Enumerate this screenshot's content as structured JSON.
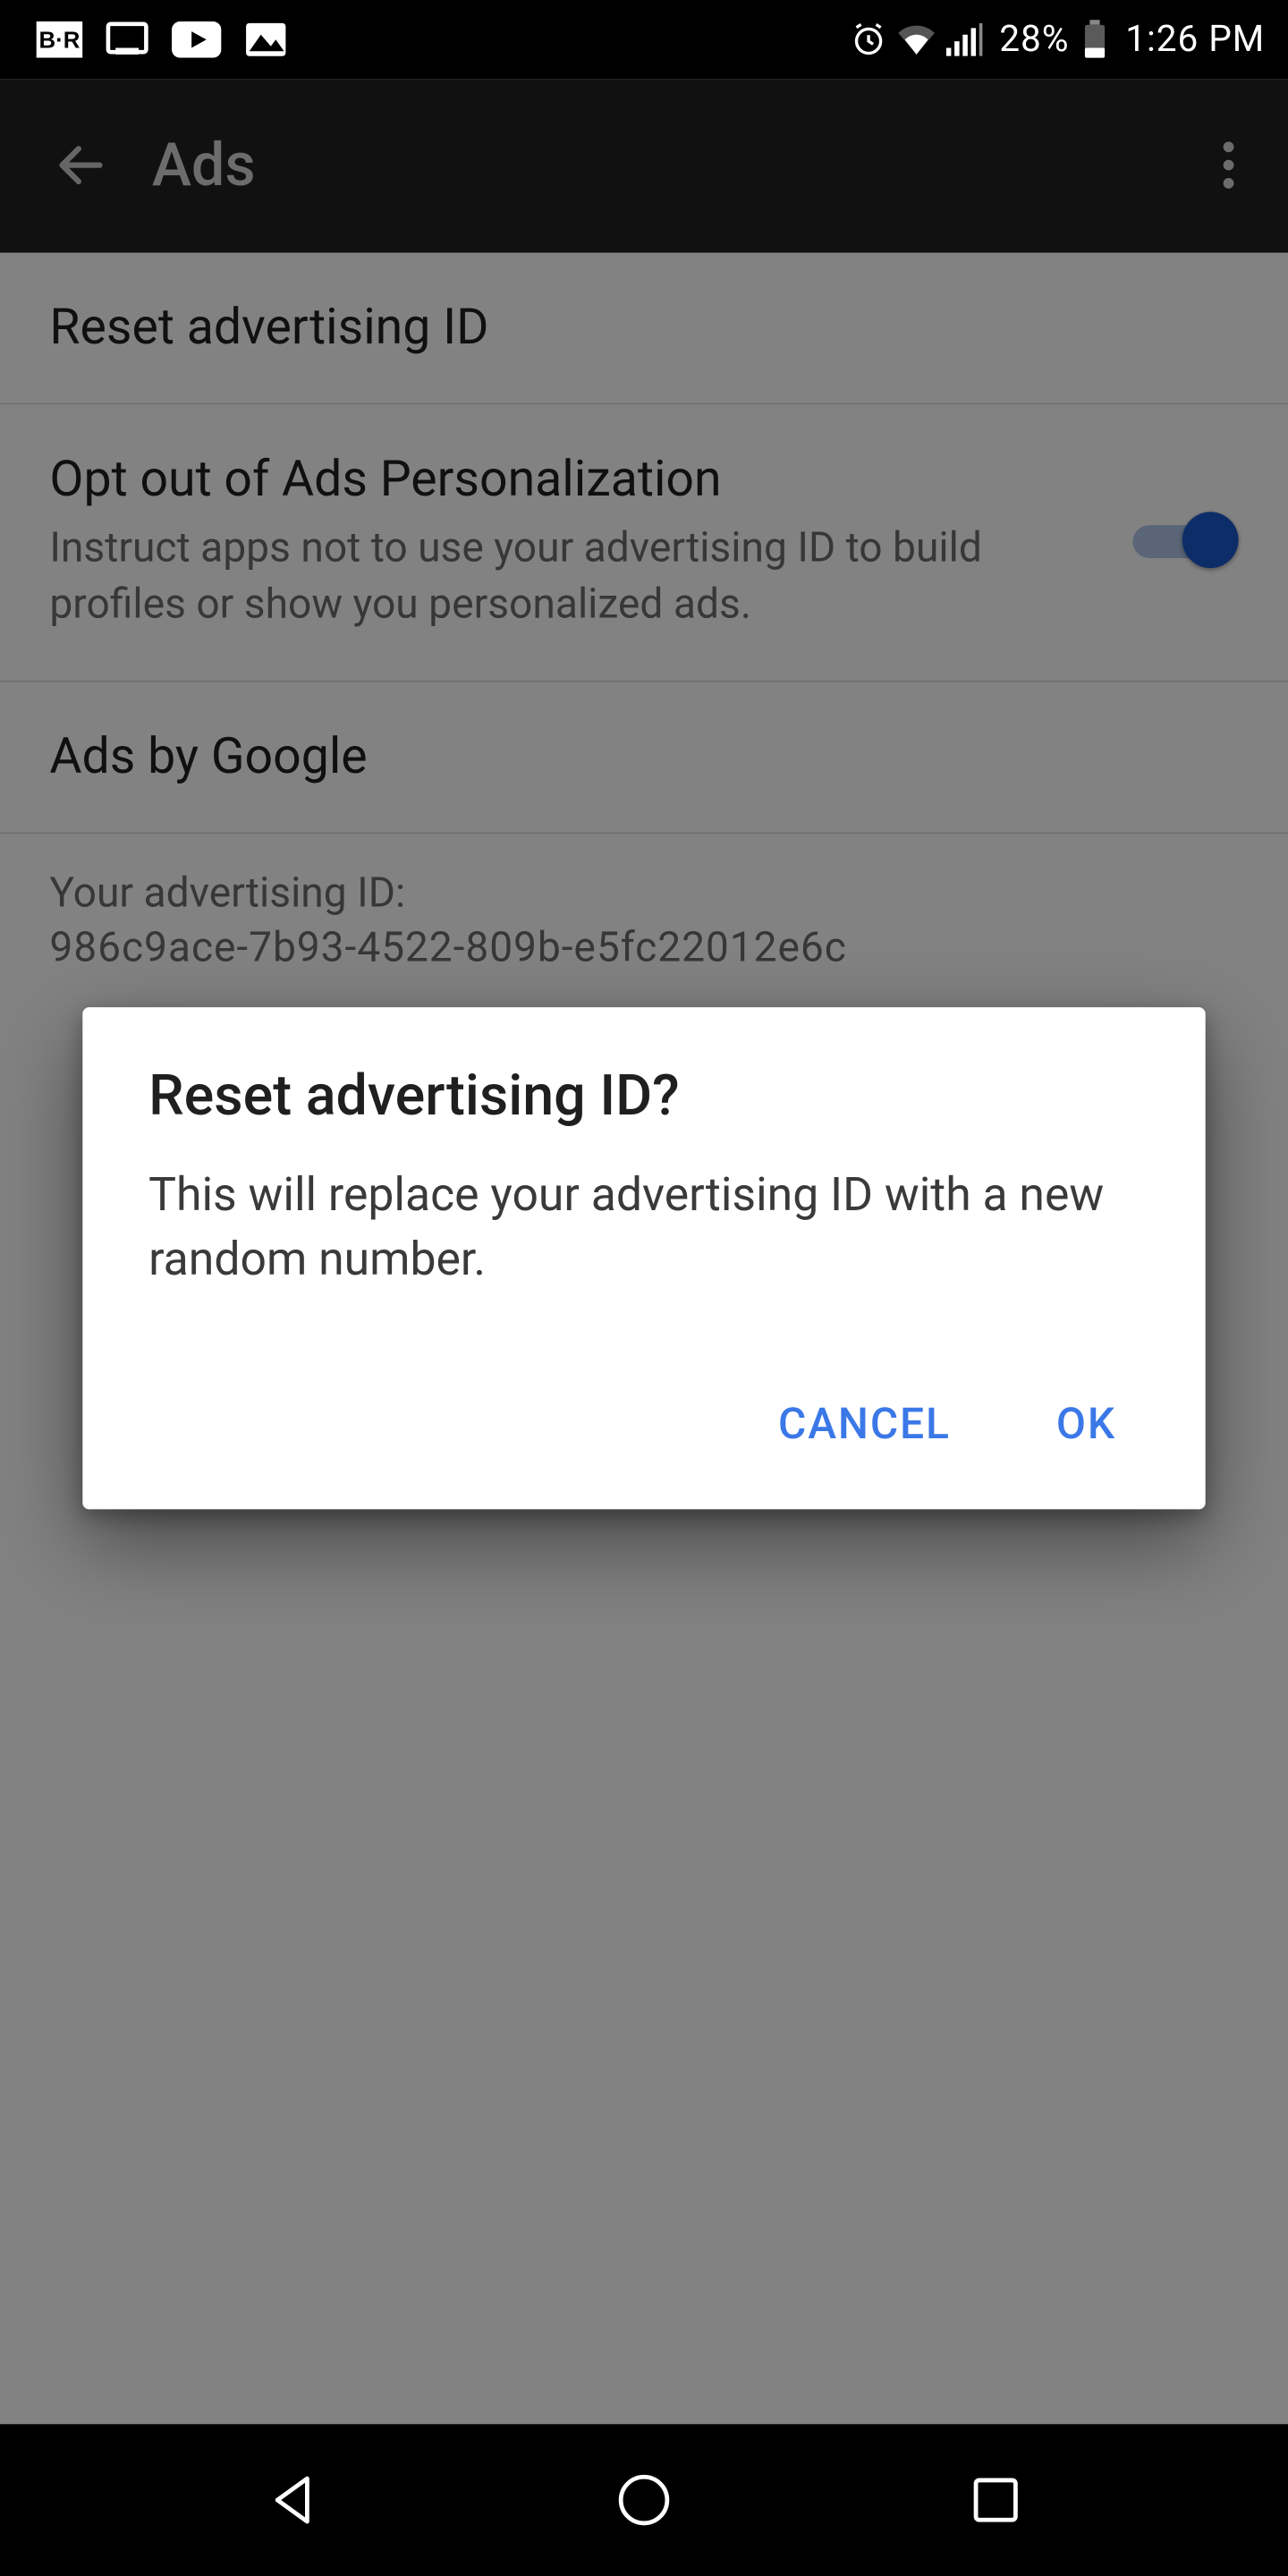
{
  "statusbar": {
    "battery_pct": "28%",
    "time": "1:26 PM"
  },
  "appbar": {
    "title": "Ads"
  },
  "settings": {
    "reset": {
      "title": "Reset advertising ID"
    },
    "optout": {
      "title": "Opt out of Ads Personalization",
      "sub": "Instruct apps not to use your advertising ID to build profiles or show you personalized ads.",
      "enabled": true
    },
    "adsby": {
      "title": "Ads by Google"
    },
    "adid": {
      "label": "Your advertising ID:",
      "value": "986c9ace-7b93-4522-809b-e5fc22012e6c"
    }
  },
  "dialog": {
    "title": "Reset advertising ID?",
    "message": "This will replace your advertising ID with a new random number.",
    "cancel": "CANCEL",
    "ok": "OK"
  }
}
